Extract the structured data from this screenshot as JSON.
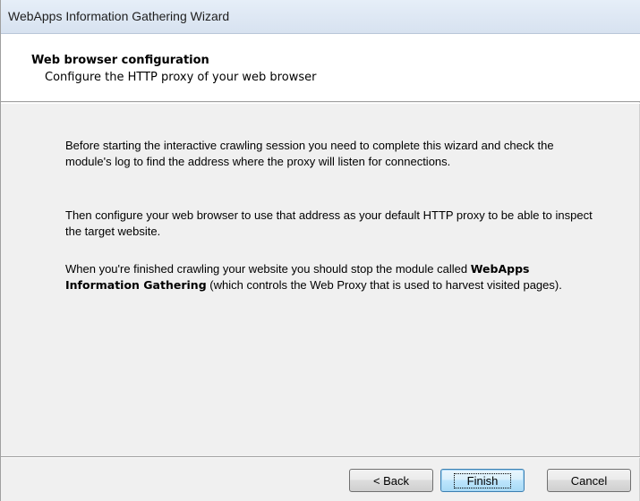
{
  "window": {
    "title": "WebApps Information Gathering Wizard"
  },
  "header": {
    "title": "Web browser configuration",
    "subtitle": "Configure the HTTP proxy of your web browser"
  },
  "content": {
    "paragraph1": "Before starting the interactive crawling session you need to complete this wizard and check the module's log to find the address where the proxy will listen for connections.",
    "paragraph2": "Then configure your web browser to use that address as your default HTTP proxy to be able to inspect the target website.",
    "paragraph3_before": "When you're finished crawling your website you should stop the module called ",
    "paragraph3_bold": "WebApps Information Gathering",
    "paragraph3_after": " (which controls the Web Proxy that is used to harvest visited pages)."
  },
  "buttons": {
    "back_label": "< Back",
    "finish_label": "Finish",
    "cancel_label": "Cancel"
  },
  "colors": {
    "titlebar": "#dbe5f2",
    "dialog_background": "#f0f0f0",
    "header_background": "#ffffff",
    "default_button_border": "#3c7fb1"
  }
}
